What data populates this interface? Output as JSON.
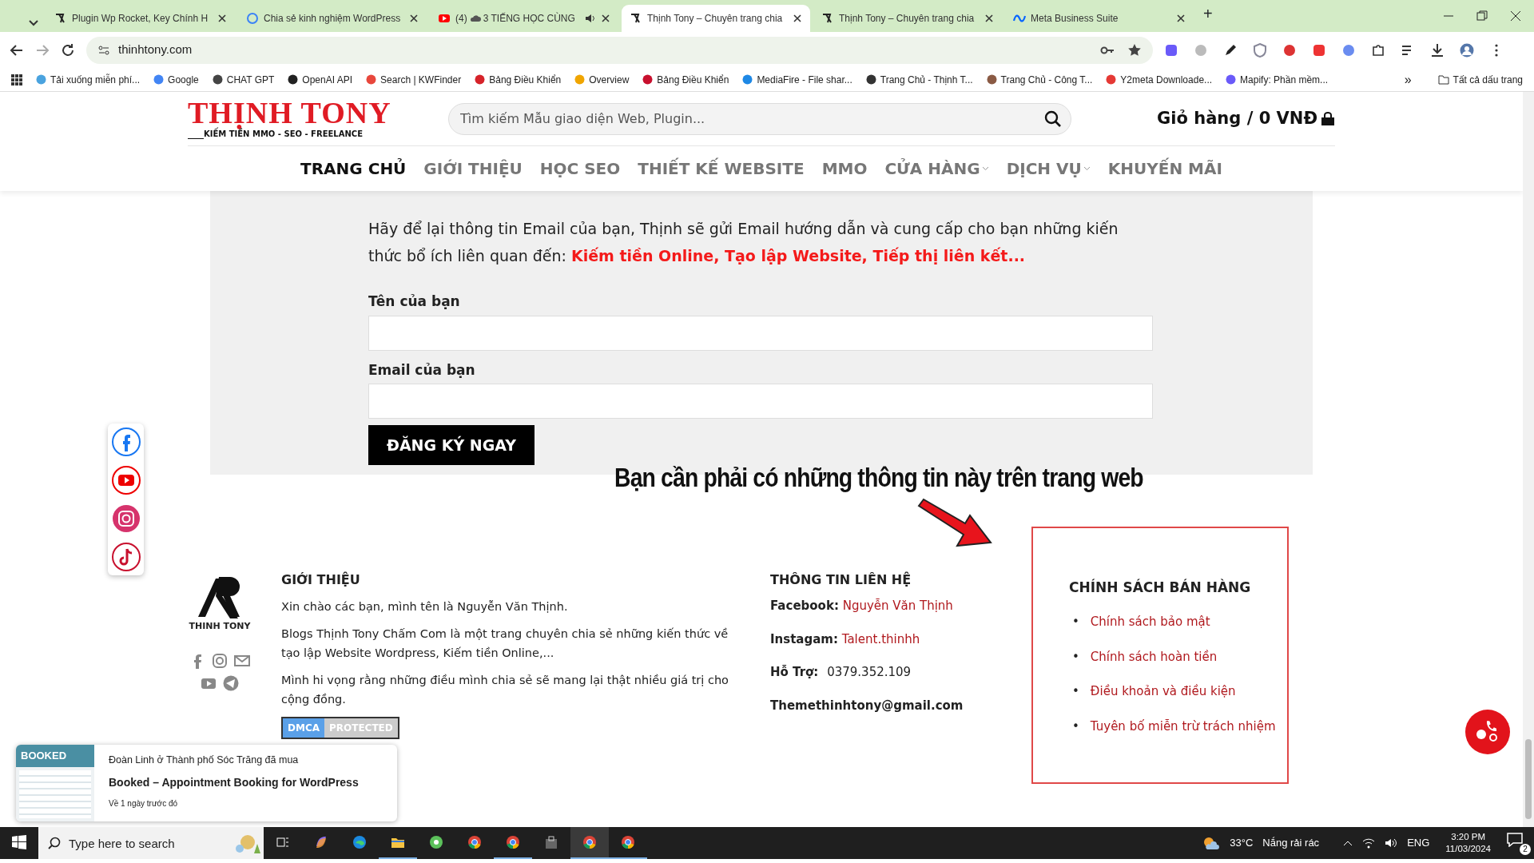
{
  "browser": {
    "tabs": [
      {
        "title": "Plugin Wp Rocket, Key Chính H",
        "selected": false,
        "audio": false,
        "kind": "site"
      },
      {
        "title": "Chia sẻ kinh nghiệm WordPress",
        "selected": false,
        "audio": false,
        "kind": "blog"
      },
      {
        "count": "(4)",
        "title": "3 TIẾNG HỌC CÙNG",
        "selected": false,
        "audio": true,
        "kind": "youtube"
      },
      {
        "title": "Thịnh Tony – Chuyên trang chia",
        "selected": true,
        "audio": false,
        "kind": "site"
      },
      {
        "title": "Thịnh Tony – Chuyên trang chia",
        "selected": false,
        "audio": false,
        "kind": "site"
      },
      {
        "title": "Meta Business Suite",
        "selected": false,
        "audio": false,
        "kind": "meta"
      }
    ],
    "new_tab": "+",
    "address": "thinhtony.com",
    "bookmarks": [
      {
        "label": "Tải xuống miễn phí...",
        "color": "#4aa3df"
      },
      {
        "label": "Google",
        "color": "#4285f4"
      },
      {
        "label": "CHAT GPT",
        "color": "#444444"
      },
      {
        "label": "OpenAI API",
        "color": "#222222"
      },
      {
        "label": "Search | KWFinder",
        "color": "#e8473c"
      },
      {
        "label": "Bảng Điều Khiển",
        "color": "#d6232a"
      },
      {
        "label": "Overview",
        "color": "#f0a500"
      },
      {
        "label": "Bảng Điều Khiển",
        "color": "#c8102e"
      },
      {
        "label": "MediaFire - File shar...",
        "color": "#1e88e5"
      },
      {
        "label": "Trang Chủ - Thịnh T...",
        "color": "#333333"
      },
      {
        "label": "Trang Chủ - Công T...",
        "color": "#8a5a44"
      },
      {
        "label": "Y2meta Downloade...",
        "color": "#e53935"
      },
      {
        "label": "Mapify: Phần mềm...",
        "color": "#6a5af9"
      }
    ],
    "more_bookmarks": "»",
    "all_bookmarks": "Tất cả dấu trang"
  },
  "site": {
    "logo": {
      "title": "THỊNH TONY",
      "tagline": "____KIẾM TIỀN MMO - SEO - FREELANCE"
    },
    "search": {
      "placeholder": "Tìm kiếm Mẫu giao diện Web, Plugin..."
    },
    "cart": "Giỏ hàng / 0 VNĐ",
    "nav": [
      {
        "label": "TRANG CHỦ",
        "selected": true,
        "dropdown": false
      },
      {
        "label": "GIỚI THIỆU",
        "selected": false,
        "dropdown": false
      },
      {
        "label": "HỌC SEO",
        "selected": false,
        "dropdown": false
      },
      {
        "label": "THIẾT KẾ WEBSITE",
        "selected": false,
        "dropdown": false
      },
      {
        "label": "MMO",
        "selected": false,
        "dropdown": false
      },
      {
        "label": "CỬA HÀNG",
        "selected": false,
        "dropdown": true
      },
      {
        "label": "DỊCH VỤ",
        "selected": false,
        "dropdown": true
      },
      {
        "label": "KHUYẾN MÃI",
        "selected": false,
        "dropdown": false
      }
    ],
    "signup": {
      "intro": "Hãy để lại thông tin Email của bạn, Thịnh sẽ gửi Email hướng dẫn và cung cấp cho bạn những kiến thức bổ ích liên quan đến:  **Kiếm tiền Online, Tạo lập Website, Tiếp thị liên kết...**",
      "fields": [
        {
          "label": "Tên của bạn"
        },
        {
          "label": "Email của bạn"
        }
      ],
      "button": "ĐĂNG KÝ NGAY"
    },
    "annotation": "Bạn cần phải có những thông tin này trên trang web",
    "footer": {
      "logo_text": "THINH TONY",
      "about": {
        "heading": "GIỚI THIỆU",
        "paragraphs": [
          "Xin chào các bạn, mình tên là Nguyễn Văn Thịnh.",
          "Blogs Thịnh Tony Chấm Com là một trang chuyên chia sẻ những kiến thức về tạo lập Website Wordpress, Kiếm tiền Online,...",
          "Mình hi vọng rằng những điều mình chia sẻ sẽ mang lại thật nhiều giá trị cho cộng đồng."
        ],
        "badge": {
          "left": "DMCA",
          "right": "PROTECTED"
        }
      },
      "contact": {
        "heading": "THÔNG TIN LIÊN HỆ",
        "rows": [
          {
            "label": "Facebook:",
            "value": "Nguyễn Văn Thịnh",
            "link": true
          },
          {
            "label": "Instagam:",
            "value": "Talent.thinhh",
            "link": true
          },
          {
            "label": "Hỗ Trợ:",
            "value": "0379.352.109",
            "link": false
          },
          {
            "label": "Themethinhtony@gmail.com"
          }
        ]
      },
      "policy": {
        "heading": "CHÍNH SÁCH BÁN HÀNG",
        "bullet": "•",
        "links": [
          "Chính sách bảo mật",
          "Chính sách hoàn tiền",
          "Điều khoản và điều kiện",
          "Tuyên bố miễn trừ trách nhiệm"
        ]
      }
    },
    "popup": {
      "image_title": "BOOKED",
      "buyer": "Đoàn Linh ở Thành phố Sóc Trăng đã mua",
      "product": "Booked – Appointment Booking for WordPress",
      "time": "Về 1 ngày trước đó"
    }
  },
  "taskbar": {
    "search_placeholder": "Type here to search",
    "apps": [
      {
        "kind": "taskview",
        "open": false,
        "selected": false
      },
      {
        "kind": "copilot",
        "open": false,
        "selected": false
      },
      {
        "kind": "edge",
        "open": false,
        "selected": false
      },
      {
        "kind": "explorer",
        "open": true,
        "selected": false
      },
      {
        "kind": "green",
        "open": false,
        "selected": false
      },
      {
        "kind": "chrome",
        "open": false,
        "selected": false
      },
      {
        "kind": "chrome",
        "open": true,
        "selected": false
      },
      {
        "kind": "store",
        "open": false,
        "selected": false
      },
      {
        "kind": "chrome",
        "open": true,
        "selected": true
      },
      {
        "kind": "chrome",
        "open": true,
        "selected": false
      }
    ],
    "temperature": "33°C",
    "weather": "Nắng rải rác",
    "language": "ENG",
    "time": "3:20 PM",
    "date": "11/03/2024",
    "notifications": "2"
  }
}
